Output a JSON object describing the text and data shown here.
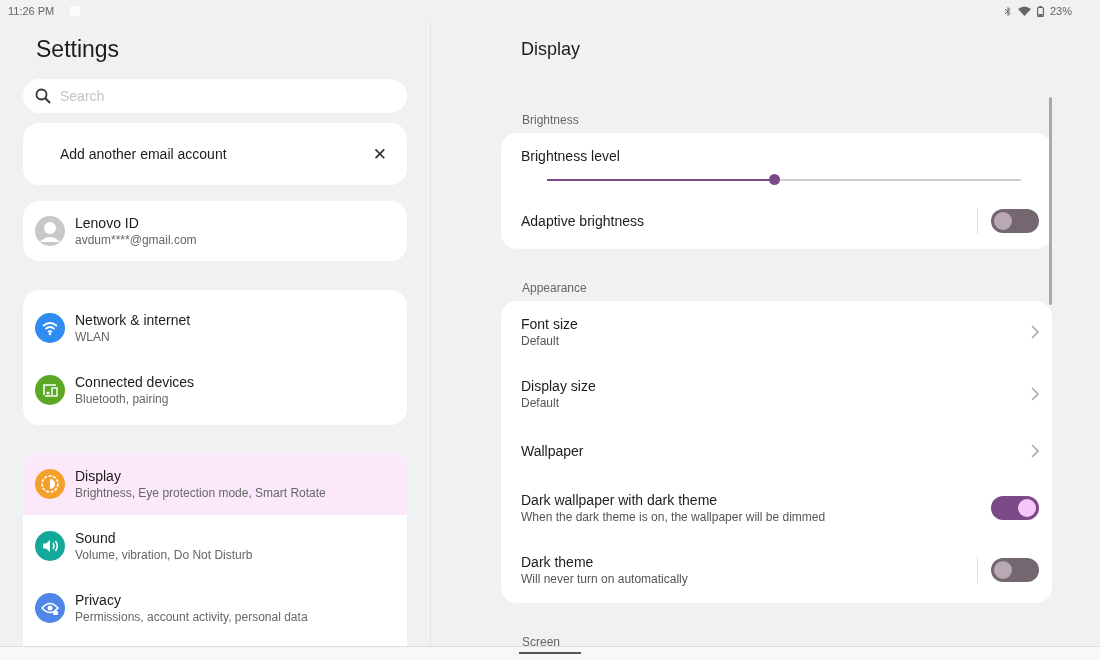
{
  "status_bar": {
    "time": "11:26 PM",
    "battery": "23%"
  },
  "sidebar": {
    "title": "Settings",
    "search": {
      "placeholder": "Search"
    },
    "banner": {
      "text": "Add another email account",
      "close": "✕"
    },
    "account": {
      "name": "Lenovo ID",
      "email": "avdum****@gmail.com"
    },
    "groups": [
      [
        {
          "kind": "wifi",
          "color": "#2f8cf0",
          "title": "Network & internet",
          "subtitle": "WLAN",
          "selected": false
        },
        {
          "kind": "devices",
          "color": "#5aa824",
          "title": "Connected devices",
          "subtitle": "Bluetooth, pairing",
          "selected": false
        }
      ],
      [
        {
          "kind": "display",
          "color": "#f4a12c",
          "title": "Display",
          "subtitle": "Brightness, Eye protection mode, Smart Rotate",
          "selected": true
        },
        {
          "kind": "sound",
          "color": "#14a89a",
          "title": "Sound",
          "subtitle": "Volume, vibration, Do Not Disturb",
          "selected": false
        },
        {
          "kind": "privacy",
          "color": "#4f86e8",
          "title": "Privacy",
          "subtitle": "Permissions, account activity, personal data",
          "selected": false
        }
      ]
    ]
  },
  "detail": {
    "title": "Display",
    "sections": [
      {
        "header": "Brightness",
        "rows": [
          {
            "kind": "slider",
            "label": "Brightness level",
            "level": 0.48
          },
          {
            "kind": "toggle",
            "label": "Adaptive brightness",
            "on": false,
            "divider": true
          }
        ]
      },
      {
        "header": "Appearance",
        "rows": [
          {
            "kind": "link",
            "label": "Font size",
            "sublabel": "Default"
          },
          {
            "kind": "link",
            "label": "Display size",
            "sublabel": "Default"
          },
          {
            "kind": "link",
            "label": "Wallpaper"
          },
          {
            "kind": "toggle",
            "label": "Dark wallpaper with dark theme",
            "sublabel": "When the dark theme is on, the wallpaper will be dimmed",
            "on": true,
            "divider": false
          },
          {
            "kind": "toggle",
            "label": "Dark theme",
            "sublabel": "Will never turn on automatically",
            "on": false,
            "divider": true
          }
        ]
      },
      {
        "header": "Screen"
      }
    ]
  }
}
